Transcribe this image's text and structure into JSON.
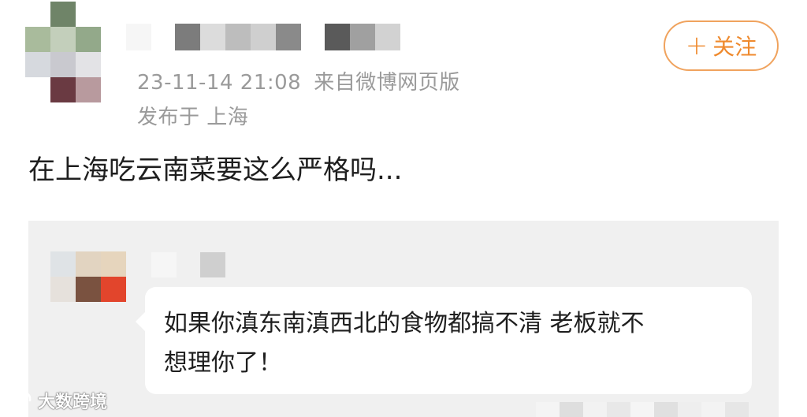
{
  "post": {
    "timestamp": "23-11-14 21:08",
    "source": "来自微博网页版",
    "location": "发布于 上海",
    "text": "在上海吃云南菜要这么严格吗...",
    "follow_label": "关注",
    "follow_icon": "plus-icon"
  },
  "quote": {
    "line1": "如果你滇东南滇西北的食物都搞不清 老板就不",
    "line2": "想理你了！"
  },
  "watermark": {
    "text": "大数跨境",
    "icon": "weibo-logo-icon"
  },
  "colors": {
    "accent": "#ef8a2e",
    "meta_text": "#9a9a9a",
    "quote_bg": "#f0f0f0"
  }
}
